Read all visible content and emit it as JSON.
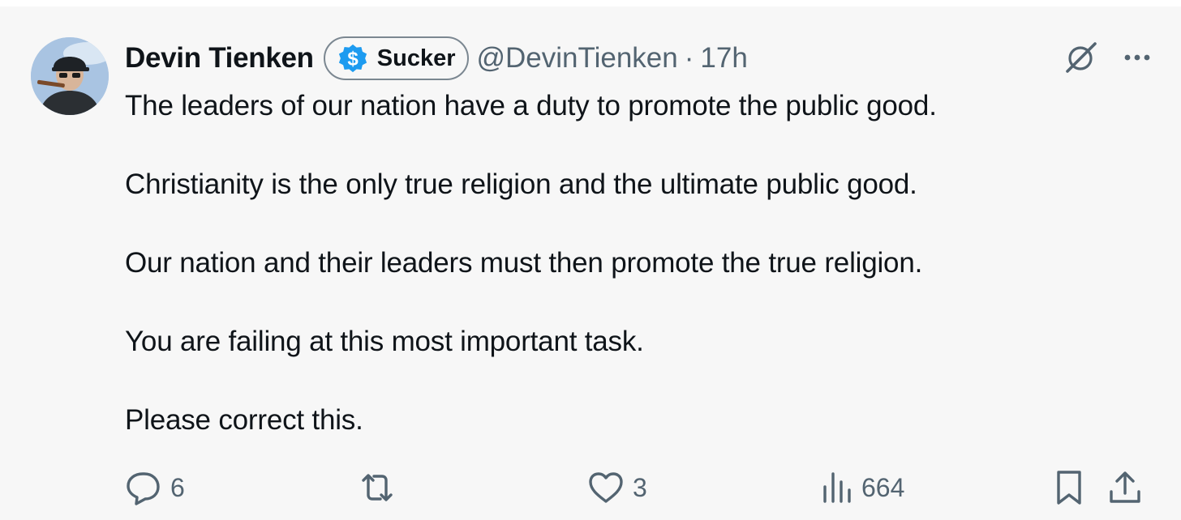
{
  "tweet": {
    "author_name": "Devin Tienken",
    "badge_label": "Sucker",
    "handle": "@DevinTienken",
    "separator": "·",
    "time": "17h",
    "paragraphs": [
      "The leaders of our nation have a duty to promote the public good.",
      "Christianity is the only true religion and the ultimate public good.",
      "Our nation and their leaders must then promote the true religion.",
      "You are failing at this most important task.",
      "Please correct this."
    ]
  },
  "icons": {
    "badge": "dollar-badge-icon",
    "top_right": [
      "grok-icon",
      "more-icon"
    ],
    "actions": [
      "reply-icon",
      "retweet-icon",
      "like-icon",
      "views-icon",
      "bookmark-icon",
      "share-icon"
    ]
  },
  "metrics": {
    "replies": "6",
    "likes": "3",
    "views": "664"
  },
  "colors": {
    "text": "#0f1419",
    "secondary": "#536471",
    "badge_blue": "#1d9bf0",
    "background": "#f7f7f7"
  }
}
